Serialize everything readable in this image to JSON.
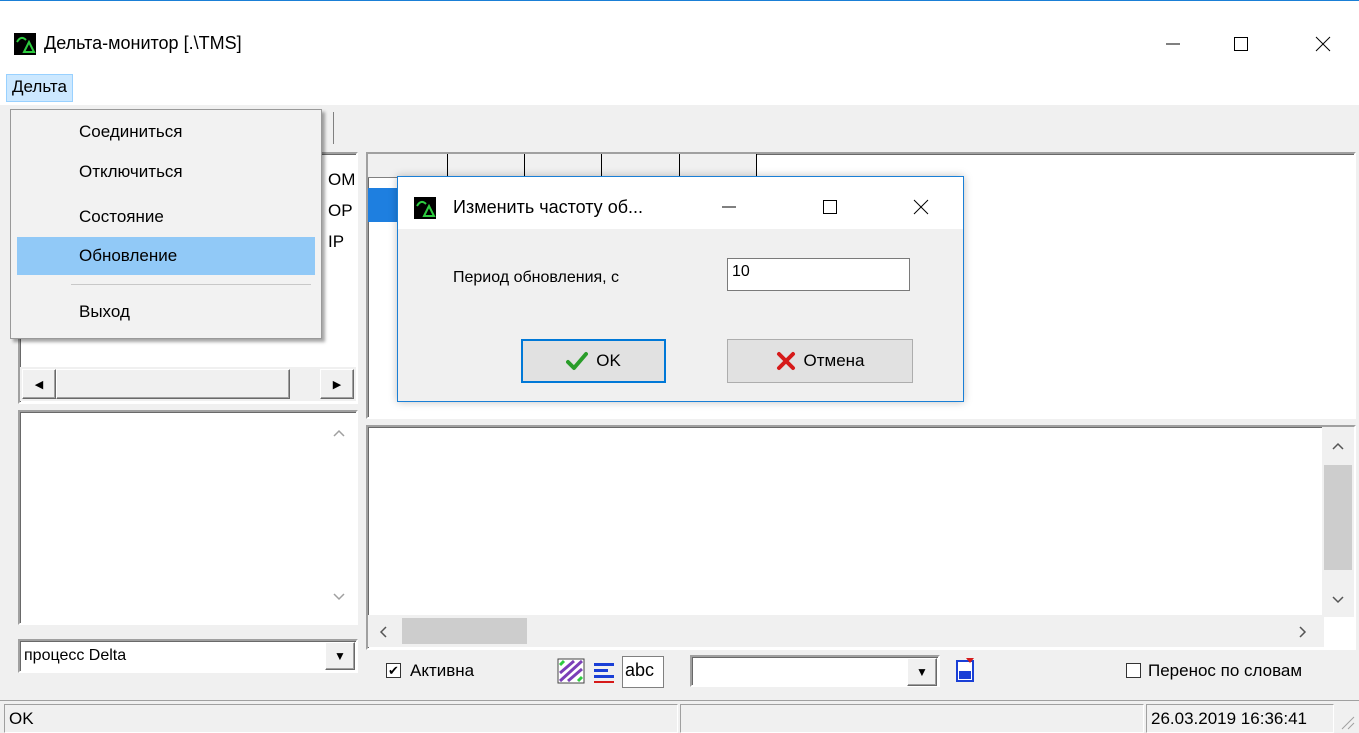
{
  "window": {
    "title": "Дельта-монитор [.\\TMS]",
    "controls": {
      "minimize": "—",
      "maximize": "☐",
      "close": "✕"
    }
  },
  "menubar": {
    "items": [
      "Дельта"
    ]
  },
  "dropdown": {
    "items": [
      "Соединиться",
      "Отключиться",
      "Состояние",
      "Обновление",
      "Выход"
    ],
    "highlighted_index": 3
  },
  "tree": {
    "fragments": [
      "OM",
      "OP",
      "IP"
    ]
  },
  "process_combo": {
    "value": "процесс Delta"
  },
  "dialog": {
    "title": "Изменить частоту об...",
    "period_label": "Период обновления, с",
    "period_value": "10",
    "ok_label": "OK",
    "cancel_label": "Отмена"
  },
  "bottom_toolbar": {
    "active_label": "Активна",
    "active_checked": true,
    "text_btn_label": "abc",
    "wrap_label": "Перенос по словам",
    "wrap_checked": false
  },
  "statusbar": {
    "left": "OK",
    "middle": "",
    "right": "26.03.2019 16:36:41"
  },
  "colors": {
    "accent": "#1a7fd6",
    "menu_highlight": "#91c9f7",
    "selection": "#1e7fe0"
  }
}
